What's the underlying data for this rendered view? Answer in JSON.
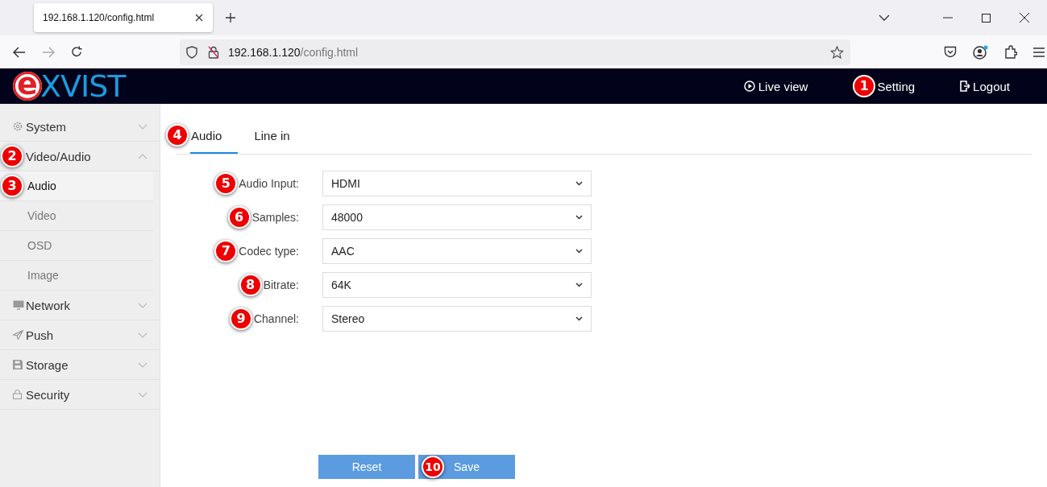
{
  "browser": {
    "tab_title": "192.168.1.120/config.html",
    "url_host": "192.168.1.120",
    "url_path": "/config.html"
  },
  "header": {
    "logo_mark": "e",
    "logo_text": "XVIST",
    "nav": [
      {
        "label": "Live view"
      },
      {
        "label": "Setting",
        "callout": "1"
      },
      {
        "label": "Logout"
      }
    ]
  },
  "sidebar": {
    "items": [
      {
        "label": "System",
        "expanded": false
      },
      {
        "label": "Video/Audio",
        "expanded": true,
        "callout": "2",
        "children": [
          {
            "label": "Audio",
            "selected": true,
            "callout": "3"
          },
          {
            "label": "Video",
            "selected": false
          },
          {
            "label": "OSD",
            "selected": false
          },
          {
            "label": "Image",
            "selected": false
          }
        ]
      },
      {
        "label": "Network",
        "expanded": false
      },
      {
        "label": "Push",
        "expanded": false
      },
      {
        "label": "Storage",
        "expanded": false
      },
      {
        "label": "Security",
        "expanded": false
      }
    ]
  },
  "tabs": [
    {
      "label": "Audio",
      "selected": true,
      "callout": "4"
    },
    {
      "label": "Line in",
      "selected": false
    }
  ],
  "form": [
    {
      "label": "Audio Input:",
      "value": "HDMI",
      "callout": "5"
    },
    {
      "label": "Samples:",
      "value": "48000",
      "callout": "6"
    },
    {
      "label": "Codec type:",
      "value": "AAC",
      "callout": "7"
    },
    {
      "label": "Bitrate:",
      "value": "64K",
      "callout": "8"
    },
    {
      "label": "Channel:",
      "value": "Stereo",
      "callout": "9"
    }
  ],
  "buttons": [
    {
      "label": "Reset"
    },
    {
      "label": "Save",
      "callout": "10"
    }
  ]
}
